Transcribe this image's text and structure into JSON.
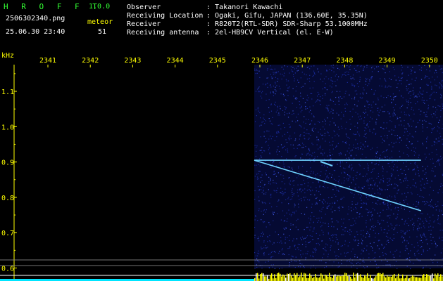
{
  "app": {
    "name": "H R O F F T",
    "version": "1.0.0",
    "filename": "2506302340.png",
    "timestamp": "25.06.30 23:40",
    "mode_label": "meteor",
    "count": "51"
  },
  "info": {
    "labels": [
      "Observer",
      "Receiving Location",
      "Receiver",
      "Receiving antenna"
    ],
    "values": [
      ": Takanori Kawachi",
      ": Ogaki, Gifu, JAPAN (136.60E, 35.35N)",
      ": R820T2(RTL-SDR) SDR-Sharp 53.1000MHz",
      ": 2el-HB9CV Vertical (el. E-W)"
    ]
  },
  "chart_data": {
    "type": "heatmap",
    "ylabel": "kHz",
    "x_ticks": [
      "2341",
      "2342",
      "2343",
      "2344",
      "2345",
      "2346",
      "2347",
      "2348",
      "2349",
      "2350"
    ],
    "y_ticks": [
      "1.1",
      "1.0",
      "0.9",
      "0.8",
      "0.7",
      "0.6"
    ],
    "ylim": [
      0.58,
      1.2
    ],
    "data_start_minute": "2346",
    "traces": [
      {
        "name": "",
        "x": [
          2346.0,
          2350.0
        ],
        "y": [
          0.905,
          0.905
        ]
      },
      {
        "name": "",
        "x": [
          2346.0,
          2350.0
        ],
        "y": [
          0.905,
          0.762
        ]
      }
    ],
    "colors": {
      "background": "#000000",
      "noise": "#1a2a99",
      "trace": "#6fd3ff",
      "axis": "#ffff00",
      "baseline": "#00e5ff"
    }
  }
}
